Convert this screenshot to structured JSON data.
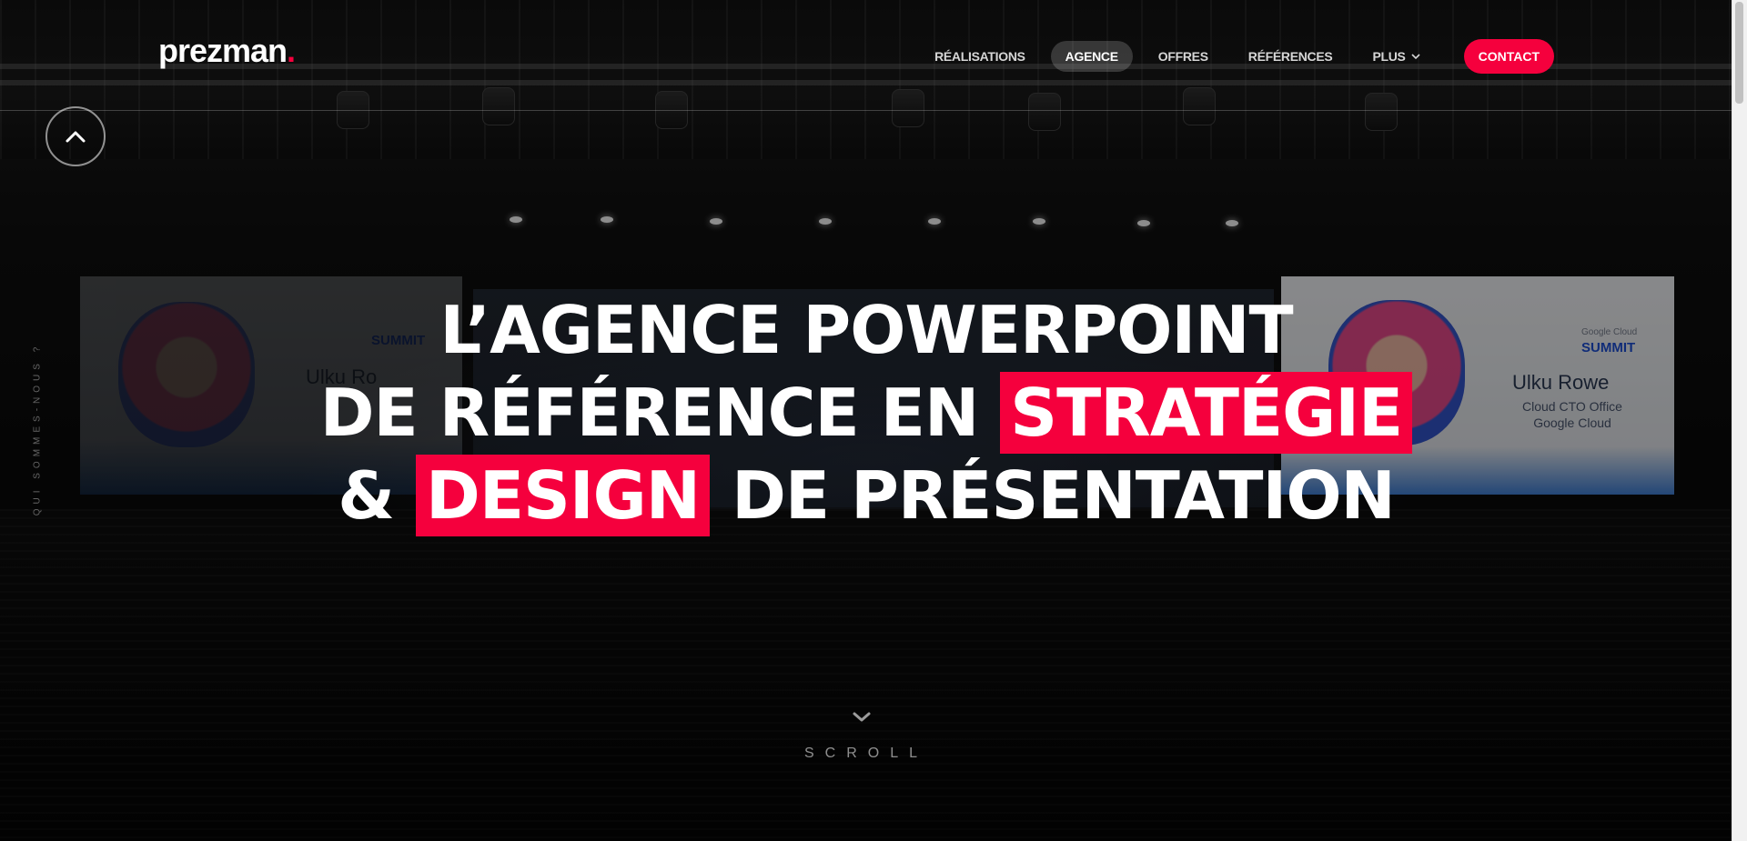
{
  "header": {
    "logo_text": "prezman",
    "logo_dot": ".",
    "nav": [
      {
        "label": "RÉALISATIONS"
      },
      {
        "label": "AGENCE",
        "active": true
      },
      {
        "label": "OFFRES"
      },
      {
        "label": "RÉFÉRENCES"
      },
      {
        "label": "PLUS",
        "icon": "chevron-down-icon"
      }
    ],
    "cta_label": "CONTACT"
  },
  "side_text": "QUI SOMMES-NOUS ?",
  "hero": {
    "line1": "L’AGENCE POWERPOINT",
    "line2_prefix": "DE RÉFÉRENCE EN ",
    "line2_highlight": "STRATÉGIE",
    "line3_prefix": "& ",
    "line3_highlight": "DESIGN",
    "line3_suffix": " DE PRÉSENTATION"
  },
  "background_screens": {
    "right_name": "Ulku Rowe",
    "right_title_1": "Cloud CTO Office",
    "right_title_2": "Google Cloud",
    "right_logo_small": "Google Cloud",
    "right_logo_big": "SUMMIT",
    "left_name": "Ulku Ro",
    "left_logo_big": "SUMMIT"
  },
  "scroll_label": "SCROLL",
  "colors": {
    "accent": "#f5003d",
    "text": "#ffffff",
    "background": "#050505"
  }
}
